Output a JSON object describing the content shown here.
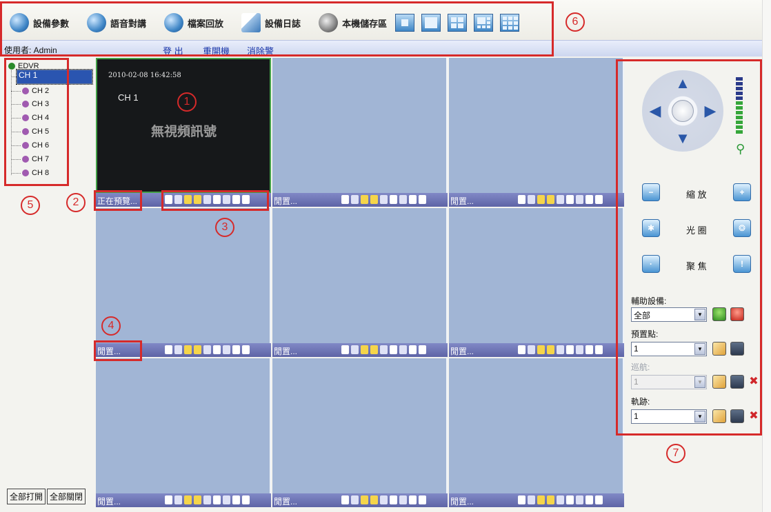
{
  "toolbar": {
    "buttons": [
      {
        "label": "設備參數",
        "icon": "device-settings-icon"
      },
      {
        "label": "語音對講",
        "icon": "voice-talk-icon"
      },
      {
        "label": "檔案回放",
        "icon": "playback-icon"
      },
      {
        "label": "設備日誌",
        "icon": "device-log-icon"
      },
      {
        "label": "本機儲存區",
        "icon": "local-storage-icon"
      }
    ],
    "layouts": [
      "layout-1-icon",
      "layout-1-large-icon",
      "layout-4-icon",
      "layout-6-icon",
      "layout-9-icon"
    ]
  },
  "userbar": {
    "user": "使用者: Admin",
    "links": [
      "登 出",
      "重開機",
      "消除警"
    ]
  },
  "tree": {
    "root": "EDVR",
    "channels": [
      "CH 1",
      "CH 2",
      "CH 3",
      "CH 4",
      "CH 5",
      "CH 6",
      "CH 7",
      "CH 8"
    ],
    "selected": "CH 1"
  },
  "buttons": {
    "open_all": "全部打開",
    "close_all": "全部關閉"
  },
  "video": {
    "timestamp": "2010-02-08 16:42:58",
    "channel": "CH 1",
    "no_signal": "無視頻訊號",
    "status_preview": "正在預覽...",
    "status_idle": "閒置..."
  },
  "ptz": {
    "zoom": "縮 放",
    "iris": "光 圈",
    "focus": "聚 焦",
    "aux_label": "輔助設備:",
    "aux_value": "全部",
    "preset_label": "預置點:",
    "preset_value": "1",
    "cruise_label": "巡航:",
    "cruise_value": "1",
    "track_label": "軌跡:",
    "track_value": "1"
  },
  "annotations": [
    "1",
    "2",
    "3",
    "4",
    "5",
    "6",
    "7"
  ],
  "colors": {
    "annotation": "#d62a2a",
    "active_border": "#43a047",
    "cell_bg": "#a1b5d5",
    "bar": "#6c73b5"
  }
}
